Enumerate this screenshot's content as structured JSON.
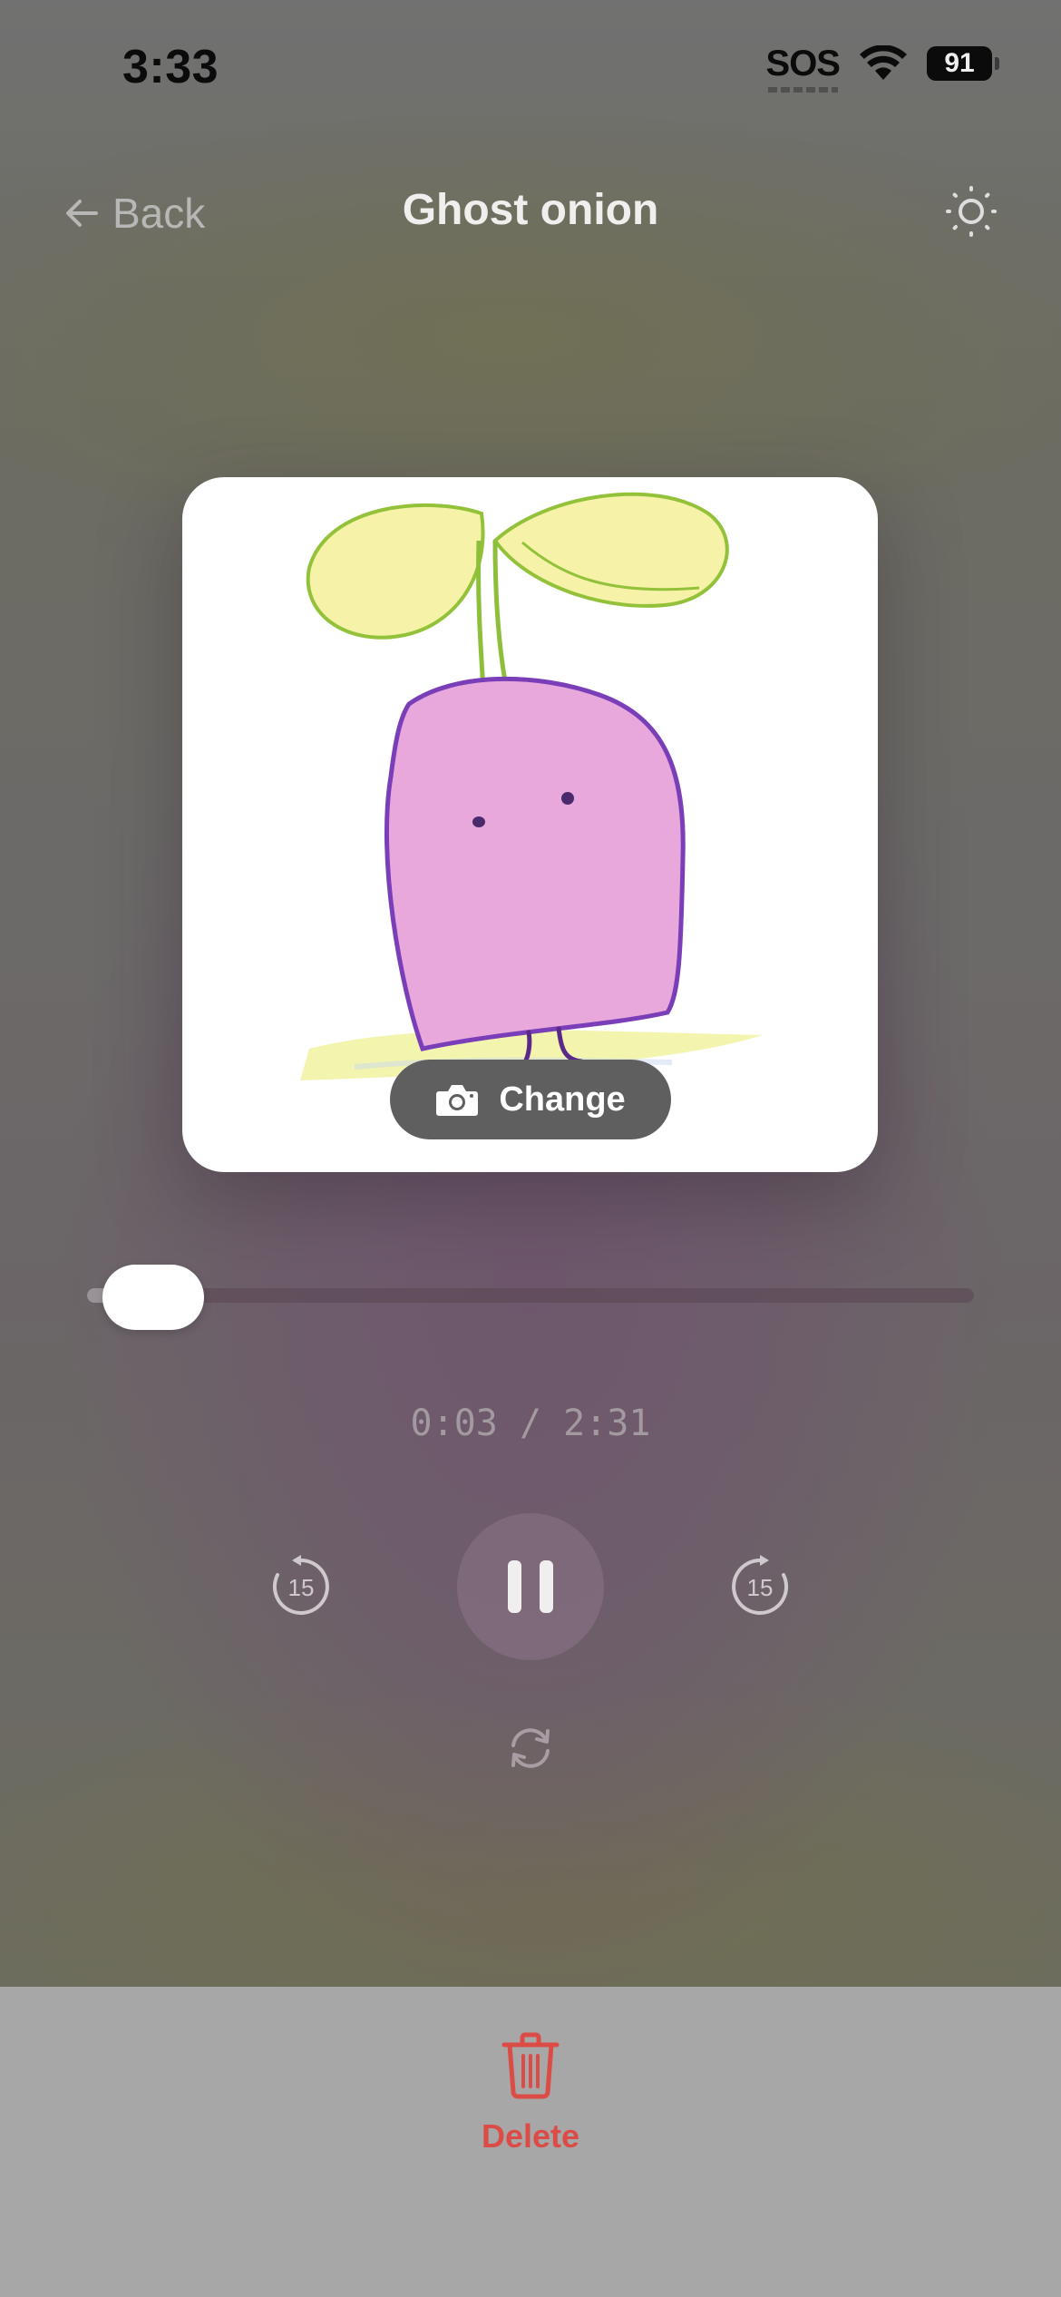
{
  "status_bar": {
    "time": "3:33",
    "sos": "SOS",
    "battery": "91",
    "icons": [
      "wifi-icon",
      "battery-icon"
    ]
  },
  "nav": {
    "back_label": "Back",
    "title": "Ghost onion",
    "icons": [
      "arrow-left-icon",
      "sun-icon"
    ]
  },
  "artwork": {
    "change_label": "Change",
    "icon": "camera-icon"
  },
  "player": {
    "progress_fraction": 0.02,
    "time_readout": "0:03 / 2:31",
    "skip_back_seconds": "15",
    "skip_forward_seconds": "15",
    "state": "playing",
    "icons": [
      "skip-back-15-icon",
      "pause-icon",
      "skip-forward-15-icon",
      "repeat-icon"
    ]
  },
  "footer": {
    "delete_label": "Delete",
    "icon": "trash-icon"
  },
  "colors": {
    "delete": "#dc4c46",
    "bottom_panel": "#a7a7a7"
  }
}
